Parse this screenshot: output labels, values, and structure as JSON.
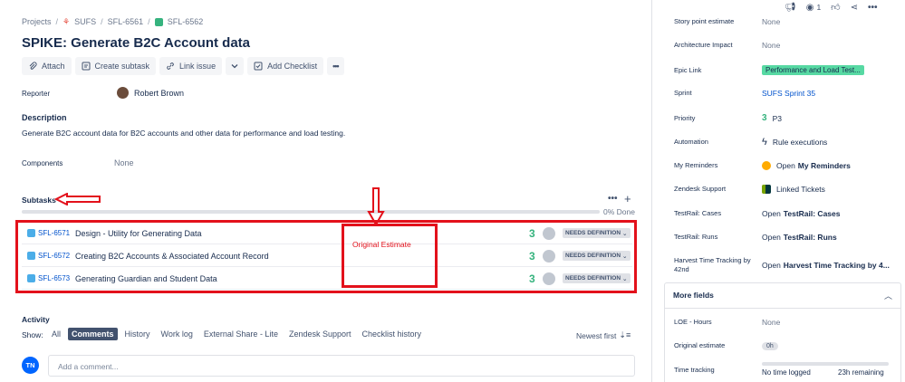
{
  "breadcrumbs": {
    "projects": "Projects",
    "project": "SUFS",
    "parent": "SFL-6561",
    "current": "SFL-6562"
  },
  "issue": {
    "title": "SPIKE: Generate B2C Account data"
  },
  "toolbar": {
    "attach": "Attach",
    "create_subtask": "Create subtask",
    "link_issue": "Link issue",
    "add_checklist": "Add Checklist",
    "more": "•••"
  },
  "topbar": {
    "watchers": "1"
  },
  "reporter": {
    "label": "Reporter",
    "name": "Robert Brown"
  },
  "description": {
    "heading": "Description",
    "text": "Generate B2C account data for B2C accounts and other data for performance and load testing."
  },
  "components": {
    "label": "Components",
    "value": "None"
  },
  "subtasks": {
    "heading": "Subtasks",
    "progress_percent": 0,
    "progress_label": "0% Done",
    "items": [
      {
        "key": "SFL-6571",
        "summary": "Design - Utility for Generating Data",
        "points": "3",
        "status": "NEEDS DEFINITION"
      },
      {
        "key": "SFL-6572",
        "summary": "Creating B2C Accounts & Associated Account Record",
        "points": "3",
        "status": "NEEDS DEFINITION"
      },
      {
        "key": "SFL-6573",
        "summary": "Generating Guardian and Student Data",
        "points": "3",
        "status": "NEEDS DEFINITION"
      }
    ]
  },
  "annotation": {
    "label": "Original Estimate",
    "color": "#e3111b"
  },
  "activity": {
    "heading": "Activity",
    "show_label": "Show:",
    "tabs": [
      "All",
      "Comments",
      "History",
      "Work log",
      "External Share - Lite",
      "Zendesk Support",
      "Checklist history"
    ],
    "active_tab": "Comments",
    "sort": "Newest first",
    "comment_placeholder": "Add a comment...",
    "user_initials": "TN"
  },
  "sidebar": {
    "fields": [
      {
        "label": "Story point estimate",
        "value": "None"
      },
      {
        "label": "Architecture Impact",
        "value": "None"
      },
      {
        "label": "Epic Link",
        "value": "Performance and Load Test..."
      },
      {
        "label": "Sprint",
        "value": "SUFS Sprint 35"
      },
      {
        "label": "Priority",
        "value": "P3",
        "num": "3"
      },
      {
        "label": "Automation",
        "value": "Rule executions"
      },
      {
        "label": "My Reminders",
        "prefix": "Open",
        "value": "My Reminders"
      },
      {
        "label": "Zendesk Support",
        "value": "Linked Tickets"
      },
      {
        "label": "TestRail: Cases",
        "prefix": "Open",
        "value": "TestRail: Cases"
      },
      {
        "label": "TestRail: Runs",
        "prefix": "Open",
        "value": "TestRail: Runs"
      },
      {
        "label": "Harvest Time Tracking by 42nd",
        "prefix": "Open",
        "value": "Harvest Time Tracking by 4..."
      }
    ],
    "more_fields": {
      "heading": "More fields",
      "loe_label": "LOE - Hours",
      "loe_value": "None",
      "orig_label": "Original estimate",
      "orig_value": "0h",
      "tt_label": "Time tracking",
      "tt_logged": "No time logged",
      "tt_remaining": "23h remaining"
    }
  },
  "colors": {
    "link": "#0052cc",
    "green": "#36b37e",
    "epic": "#57d9a3",
    "annotation_red": "#e3111b"
  }
}
